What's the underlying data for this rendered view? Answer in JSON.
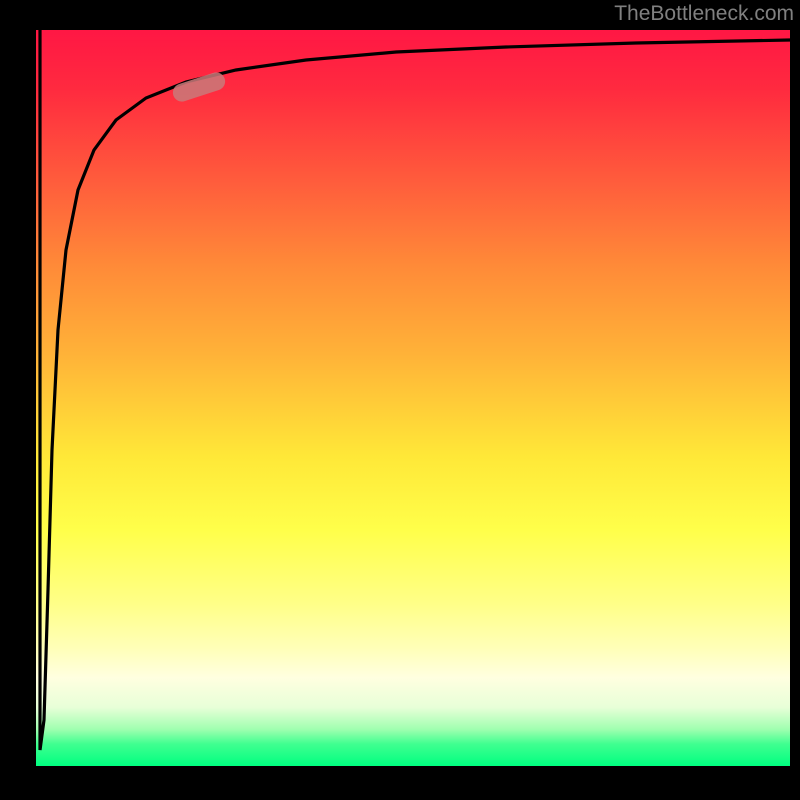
{
  "watermark": "TheBottleneck.com",
  "chart_data": {
    "type": "line",
    "title": "",
    "xlabel": "",
    "ylabel": "",
    "xlim": [
      0,
      100
    ],
    "ylim": [
      0,
      100
    ],
    "grid": false,
    "series": [
      {
        "name": "curve",
        "x": [
          0,
          0.5,
          1,
          1.5,
          2,
          3,
          4,
          6,
          8,
          12,
          16,
          24,
          32,
          48,
          64,
          80,
          100
        ],
        "y": [
          100,
          20,
          2,
          30,
          55,
          72,
          80,
          86,
          89,
          91.5,
          93,
          94.5,
          95.2,
          96,
          96.5,
          96.8,
          97
        ]
      }
    ],
    "annotations": [
      {
        "type": "marker",
        "x": 22,
        "y": 90.5,
        "style": "pill",
        "color": "#c97a7a"
      }
    ],
    "background_gradient": {
      "direction": "vertical",
      "stops": [
        {
          "pos": 0,
          "color": "#ff1744"
        },
        {
          "pos": 0.5,
          "color": "#ffe838"
        },
        {
          "pos": 0.9,
          "color": "#ffffe0"
        },
        {
          "pos": 1.0,
          "color": "#00ff80"
        }
      ]
    }
  }
}
